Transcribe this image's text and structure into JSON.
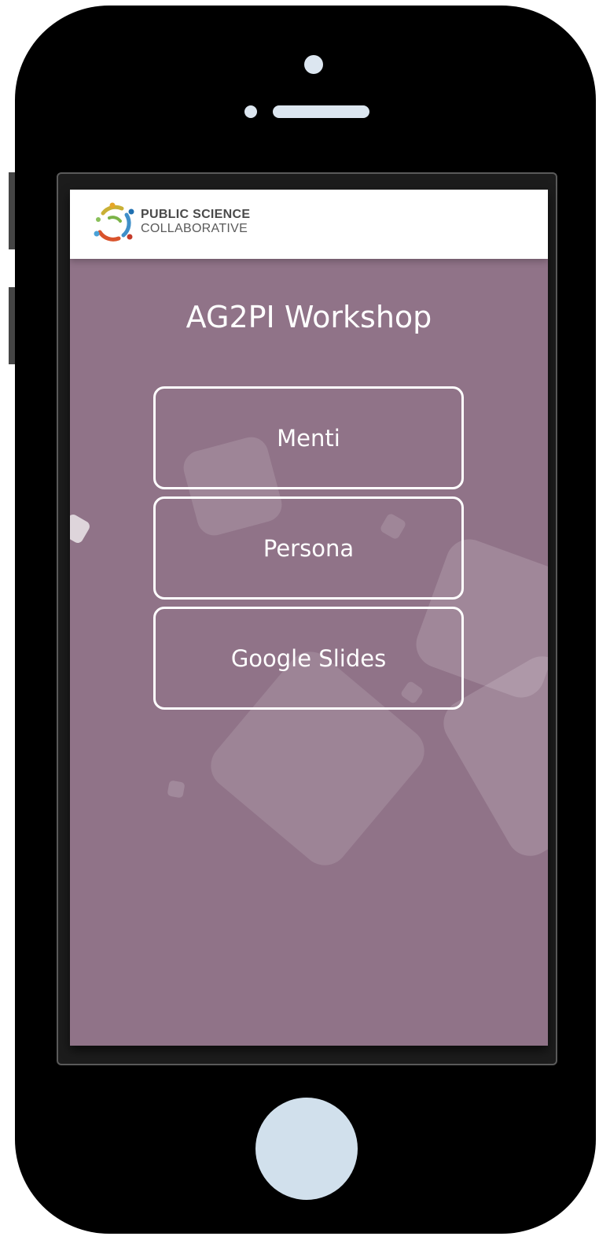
{
  "app": {
    "logo": {
      "line1": "PUBLIC SCIENCE",
      "line2": "COLLABORATIVE",
      "icon": "public-science-collaborative-logo"
    },
    "title": "AG2PI Workshop",
    "buttons": [
      {
        "label": "Menti"
      },
      {
        "label": "Persona"
      },
      {
        "label": "Google Slides"
      }
    ]
  },
  "colors": {
    "background": "#907388",
    "header": "#ffffff",
    "button_border": "#ffffff",
    "device_body": "#000000",
    "device_accents": "#d1e0ec"
  }
}
